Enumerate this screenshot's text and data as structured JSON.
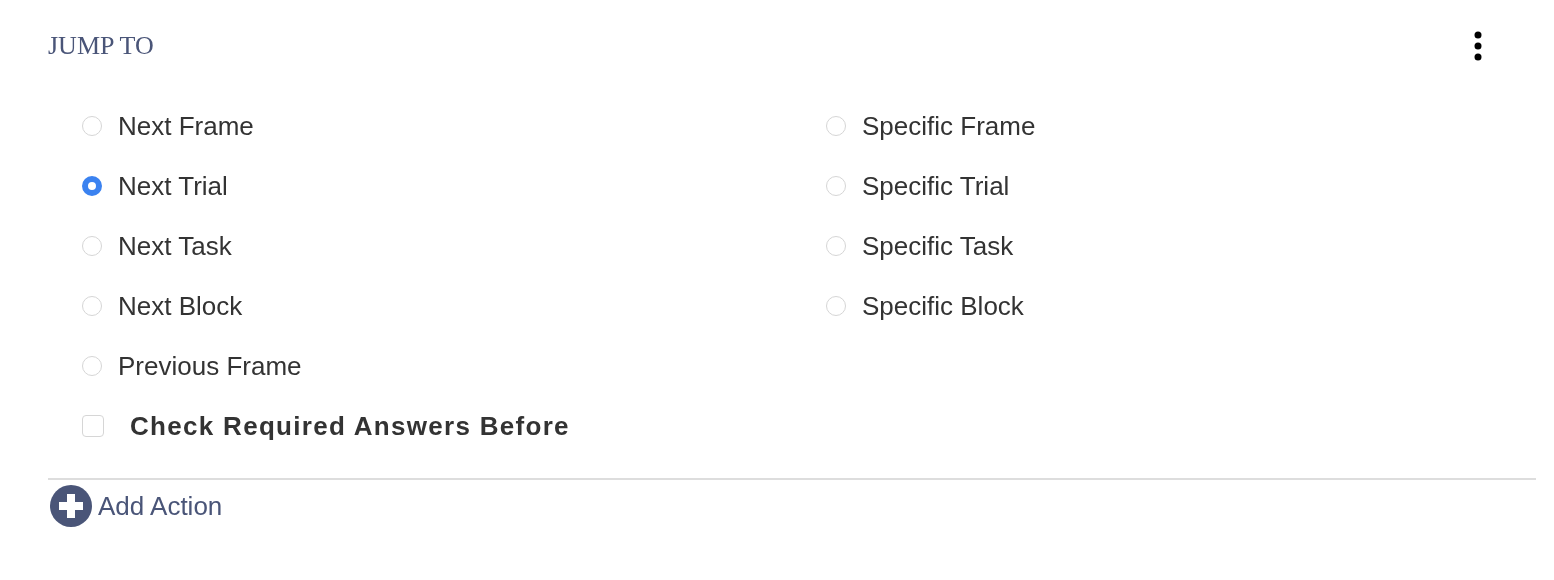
{
  "section": {
    "title": "JUMP TO"
  },
  "columns": [
    {
      "options": [
        {
          "label": "Next Frame",
          "selected": false
        },
        {
          "label": "Next Trial",
          "selected": true
        },
        {
          "label": "Next Task",
          "selected": false
        },
        {
          "label": "Next Block",
          "selected": false
        },
        {
          "label": "Previous Frame",
          "selected": false
        }
      ]
    },
    {
      "options": [
        {
          "label": "Specific Frame",
          "selected": false
        },
        {
          "label": "Specific Trial",
          "selected": false
        },
        {
          "label": "Specific Task",
          "selected": false
        },
        {
          "label": "Specific Block",
          "selected": false
        }
      ]
    }
  ],
  "check_required": {
    "label": "Check Required Answers Before",
    "checked": false
  },
  "add_action": {
    "label": "Add Action"
  }
}
